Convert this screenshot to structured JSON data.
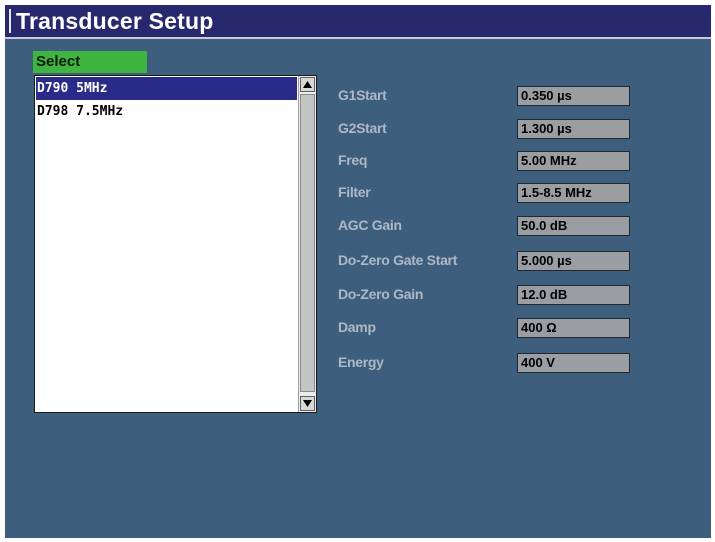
{
  "title": "Transducer Setup",
  "select_label": "Select",
  "list": {
    "items": [
      {
        "label": "D790 5MHz",
        "selected": true
      },
      {
        "label": "D798 7.5MHz",
        "selected": false
      }
    ]
  },
  "params": [
    {
      "label": "G1Start",
      "value": "0.350  µs"
    },
    {
      "label": "G2Start",
      "value": "1.300  µs"
    },
    {
      "label": "Freq",
      "value": "5.00 MHz"
    },
    {
      "label": "Filter",
      "value": "1.5-8.5 MHz"
    },
    {
      "label": "AGC Gain",
      "value": "50.0 dB"
    },
    {
      "label": "Do-Zero Gate Start",
      "value": "5.000  µs"
    },
    {
      "label": "Do-Zero Gain",
      "value": "12.0 dB"
    },
    {
      "label": "Damp",
      "value": "400 Ω"
    },
    {
      "label": "Energy",
      "value": "400 V"
    }
  ],
  "colors": {
    "title_bar": "#28286e",
    "screen_bg": "#3d5f7d",
    "select_tab": "#3fb440",
    "selected_item": "#2a2a8a",
    "value_box": "#9a9ea2"
  },
  "icons": {
    "scroll_up": "triangle-up-icon",
    "scroll_down": "triangle-down-icon"
  }
}
